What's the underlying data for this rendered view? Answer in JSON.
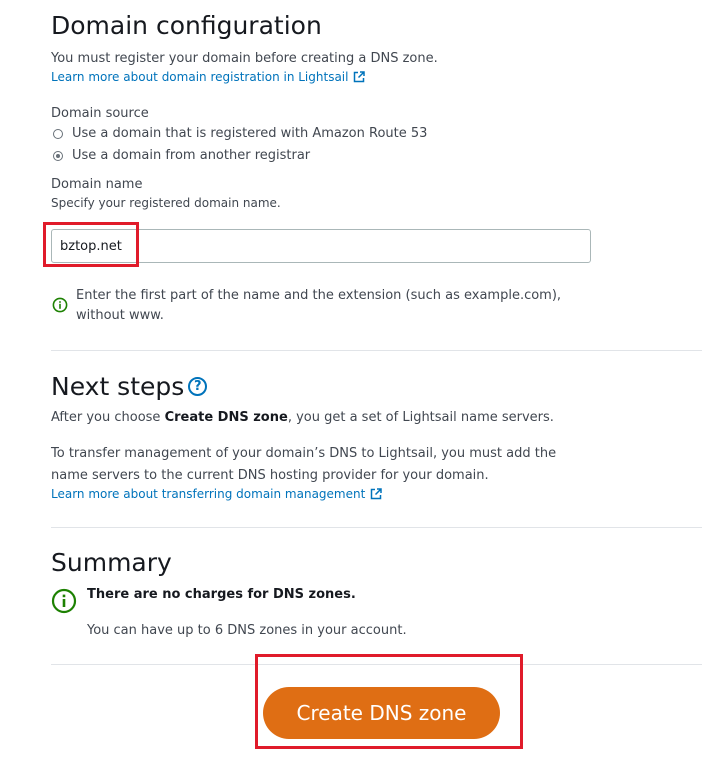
{
  "domain_config": {
    "title": "Domain configuration",
    "description": "You must register your domain before creating a DNS zone.",
    "learn_more_link": "Learn more about domain registration in Lightsail",
    "domain_source": {
      "label": "Domain source",
      "options": [
        {
          "label": "Use a domain that is registered with Amazon Route 53",
          "selected": false
        },
        {
          "label": "Use a domain from another registrar",
          "selected": true
        }
      ]
    },
    "domain_name": {
      "label": "Domain name",
      "hint": "Specify your registered domain name.",
      "value": "bztop.net",
      "info_line1": "Enter the first part of the name and the extension (such as example.com),",
      "info_line2": "without www."
    }
  },
  "next_steps": {
    "title": "Next steps",
    "para1_prefix": "After you choose ",
    "para1_bold": "Create DNS zone",
    "para1_suffix": ", you get a set of Lightsail name servers.",
    "para2_line1": "To transfer management of your domain’s DNS to Lightsail, you must add the",
    "para2_line2": "name servers to the current DNS hosting provider for your domain.",
    "learn_more_link": "Learn more about transferring domain management"
  },
  "summary": {
    "title": "Summary",
    "charge_notice": "There are no charges for DNS zones.",
    "limit_text": "You can have up to 6 DNS zones in your account."
  },
  "actions": {
    "create_label": "Create DNS zone"
  },
  "colors": {
    "accent": "#df6e14",
    "link": "#0073bb",
    "success": "#1d8102",
    "highlight": "#e01b2a"
  },
  "icons": {
    "external_link": "external-link-icon",
    "info": "info-icon",
    "help": "help-icon"
  }
}
